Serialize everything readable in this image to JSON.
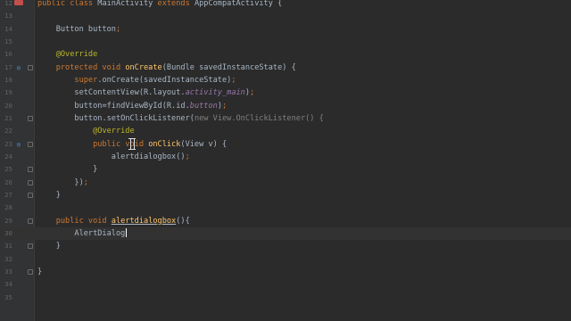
{
  "editor": {
    "lines": [
      {
        "num": "12",
        "marker": "",
        "fold": false,
        "tokens": [
          {
            "t": "public class ",
            "c": "kw"
          },
          {
            "t": "MainActivity ",
            "c": ""
          },
          {
            "t": "extends ",
            "c": "kw"
          },
          {
            "t": "AppCompatActivity {",
            "c": ""
          }
        ]
      },
      {
        "num": "13",
        "marker": "",
        "fold": false,
        "tokens": []
      },
      {
        "num": "14",
        "marker": "",
        "fold": false,
        "tokens": [
          {
            "t": "    Button ",
            "c": ""
          },
          {
            "t": "button",
            "c": "it2"
          },
          {
            "t": ";",
            "c": "kw"
          }
        ]
      },
      {
        "num": "15",
        "marker": "",
        "fold": false,
        "tokens": []
      },
      {
        "num": "16",
        "marker": "",
        "fold": false,
        "tokens": [
          {
            "t": "    @Override",
            "c": "ann"
          }
        ]
      },
      {
        "num": "17",
        "marker": "o",
        "fold": true,
        "tokens": [
          {
            "t": "    protected void ",
            "c": "kw"
          },
          {
            "t": "onCreate",
            "c": "fn"
          },
          {
            "t": "(Bundle savedInstanceState) {",
            "c": ""
          }
        ]
      },
      {
        "num": "18",
        "marker": "",
        "fold": false,
        "tokens": [
          {
            "t": "        ",
            "c": ""
          },
          {
            "t": "super",
            "c": "kw"
          },
          {
            "t": ".onCreate(savedInstanceState)",
            "c": ""
          },
          {
            "t": ";",
            "c": "kw"
          }
        ]
      },
      {
        "num": "19",
        "marker": "",
        "fold": false,
        "tokens": [
          {
            "t": "        setContentView(R.layout.",
            "c": ""
          },
          {
            "t": "activity_main",
            "c": "it"
          },
          {
            "t": ")",
            "c": ""
          },
          {
            "t": ";",
            "c": "kw"
          }
        ]
      },
      {
        "num": "20",
        "marker": "",
        "fold": false,
        "tokens": [
          {
            "t": "        ",
            "c": ""
          },
          {
            "t": "button",
            "c": "it2"
          },
          {
            "t": "=findViewById(R.id.",
            "c": ""
          },
          {
            "t": "button",
            "c": "it"
          },
          {
            "t": ")",
            "c": ""
          },
          {
            "t": ";",
            "c": "kw"
          }
        ]
      },
      {
        "num": "21",
        "marker": "",
        "fold": true,
        "tokens": [
          {
            "t": "        ",
            "c": ""
          },
          {
            "t": "button",
            "c": "it2"
          },
          {
            "t": ".setOnClickListener(",
            "c": ""
          },
          {
            "t": "new ",
            "c": "grey"
          },
          {
            "t": "View.OnClickListener() {",
            "c": "grey"
          }
        ]
      },
      {
        "num": "22",
        "marker": "",
        "fold": false,
        "tokens": [
          {
            "t": "            @Override",
            "c": "ann"
          }
        ]
      },
      {
        "num": "23",
        "marker": "o",
        "fold": true,
        "tokens": [
          {
            "t": "            public ",
            "c": "kw"
          },
          {
            "t": "void ",
            "c": "kw"
          },
          {
            "t": "onClick",
            "c": "fn"
          },
          {
            "t": "(View v) {",
            "c": ""
          }
        ]
      },
      {
        "num": "24",
        "marker": "",
        "fold": false,
        "tokens": [
          {
            "t": "                alertdialogbox()",
            "c": ""
          },
          {
            "t": ";",
            "c": "kw"
          }
        ]
      },
      {
        "num": "25",
        "marker": "",
        "fold": true,
        "tokens": [
          {
            "t": "            }",
            "c": ""
          }
        ]
      },
      {
        "num": "26",
        "marker": "",
        "fold": true,
        "tokens": [
          {
            "t": "        })",
            "c": ""
          },
          {
            "t": ";",
            "c": "kw"
          }
        ]
      },
      {
        "num": "27",
        "marker": "",
        "fold": true,
        "tokens": [
          {
            "t": "    }",
            "c": ""
          }
        ]
      },
      {
        "num": "28",
        "marker": "",
        "fold": false,
        "tokens": []
      },
      {
        "num": "29",
        "marker": "",
        "fold": true,
        "tokens": [
          {
            "t": "    public void ",
            "c": "kw"
          },
          {
            "t": "alertdialogbox",
            "c": "fnu"
          },
          {
            "t": "(){",
            "c": ""
          }
        ]
      },
      {
        "num": "30",
        "marker": "",
        "fold": false,
        "current": true,
        "tokens": [
          {
            "t": "        AlertDialog",
            "c": ""
          }
        ]
      },
      {
        "num": "31",
        "marker": "",
        "fold": true,
        "tokens": [
          {
            "t": "    }",
            "c": ""
          }
        ]
      },
      {
        "num": "32",
        "marker": "",
        "fold": false,
        "tokens": []
      },
      {
        "num": "33",
        "marker": "",
        "fold": true,
        "tokens": [
          {
            "t": "}",
            "c": ""
          }
        ]
      },
      {
        "num": "34",
        "marker": "",
        "fold": false,
        "tokens": []
      },
      {
        "num": "35",
        "marker": "",
        "fold": false,
        "tokens": []
      }
    ]
  }
}
